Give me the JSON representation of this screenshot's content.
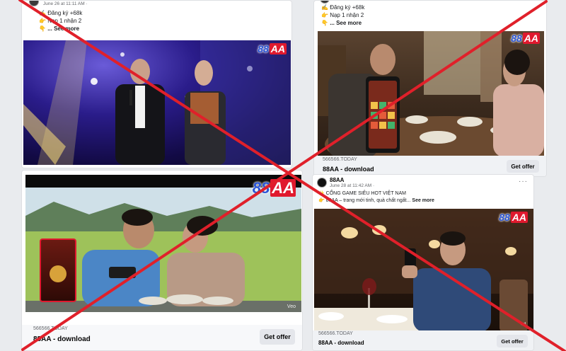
{
  "colors": {
    "cross": "#e0202a",
    "page_bg": "#e9ebee",
    "card_bg": "#ffffff",
    "footer_bg": "#f0f2f5",
    "brand_blue": "#2a55d6",
    "brand_red": "#e0192e"
  },
  "logo": {
    "digits": "88",
    "letters": "AA"
  },
  "posts": [
    {
      "time": "June 26 at 11:11 AM · ",
      "lines": [
        "Đăng ký +68k",
        "Nạp 1 nhận 2"
      ],
      "see_more": "... See more"
    },
    {
      "lines": [
        "Đăng ký +68k",
        "Nạp 1 nhận 2"
      ],
      "see_more": "... See more",
      "domain": "566566.TODAY",
      "ad_title": "88AA - download",
      "button": "Get offer"
    },
    {
      "domain": "566566.TODAY",
      "ad_title": "88AA - download",
      "button": "Get offer",
      "watermark": "Veo"
    },
    {
      "name": "88AA",
      "time": "June 28 at 11:42 AM · ",
      "lines": [
        "CỔNG GAME SIÊU HOT VIỆT NAM",
        "88AA – trang mới tinh, quà chất ngất..."
      ],
      "see_more": "See more",
      "domain": "566566.TODAY",
      "ad_title": "88AA - download",
      "button": "Get offer"
    }
  ]
}
